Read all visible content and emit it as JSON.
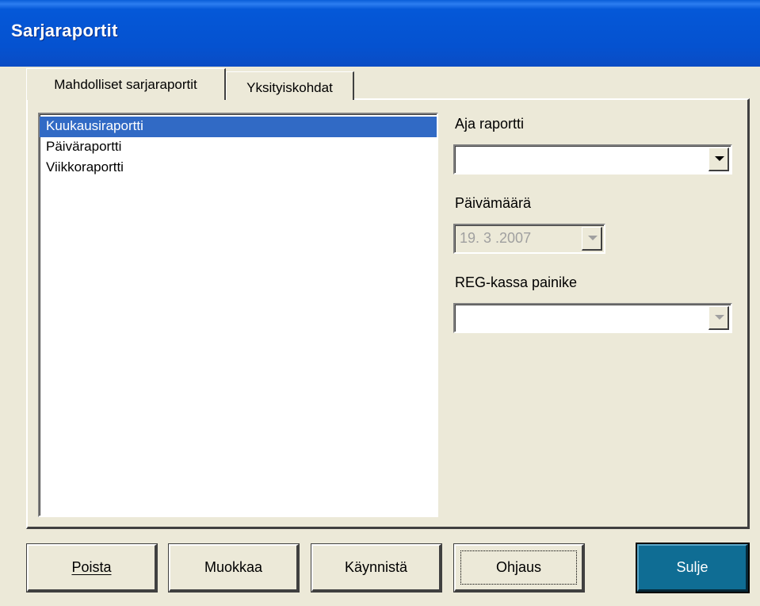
{
  "window": {
    "title": "Sarjaraportit"
  },
  "tabs": [
    {
      "label": "Mahdolliset sarjaraportit",
      "active": true
    },
    {
      "label": "Yksityiskohdat",
      "active": false
    }
  ],
  "report_list": {
    "items": [
      {
        "label": "Kuukausiraportti",
        "selected": true
      },
      {
        "label": "Päiväraportti",
        "selected": false
      },
      {
        "label": "Viikkoraportti",
        "selected": false
      }
    ]
  },
  "run_report": {
    "label": "Aja raportti",
    "value": ""
  },
  "date": {
    "label": "Päivämäärä",
    "value": "19. 3 .2007",
    "enabled": false
  },
  "reg_button": {
    "label": "REG-kassa painike",
    "value": "",
    "enabled": false
  },
  "buttons": {
    "delete": "Poista",
    "edit": "Muokkaa",
    "start": "Käynnistä",
    "control": "Ohjaus",
    "close": "Sulje"
  },
  "colors": {
    "titlebar": "#0558d8",
    "selection": "#316ac5",
    "default_button": "#0f6d94",
    "face": "#ece9d8"
  },
  "icons": {
    "dropdown": "chevron-down-icon"
  }
}
